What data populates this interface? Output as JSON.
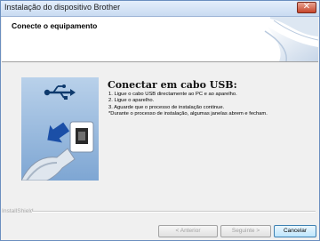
{
  "window": {
    "title": "Instalação do dispositivo Brother"
  },
  "header": {
    "title": "Conecte o equipamento"
  },
  "main": {
    "heading": "Conectar em cabo USB:",
    "steps": [
      "1. Ligue o cabo USB directamente ao PC e ao aparelho.",
      "2. Ligue o aparelho.",
      "3. Aguarde que o processo de instalação continue.",
      "*Durante o processo de instalação, algumas janelas abrem e fecham."
    ]
  },
  "footer": {
    "brand": "InstallShield",
    "back_label": "< Anterior",
    "next_label": "Seguinte >",
    "cancel_label": "Cancelar"
  },
  "icons": {
    "close": "close-icon",
    "usb": "usb-icon",
    "arrow": "arrow-icon",
    "plug": "usb-plug-icon"
  }
}
